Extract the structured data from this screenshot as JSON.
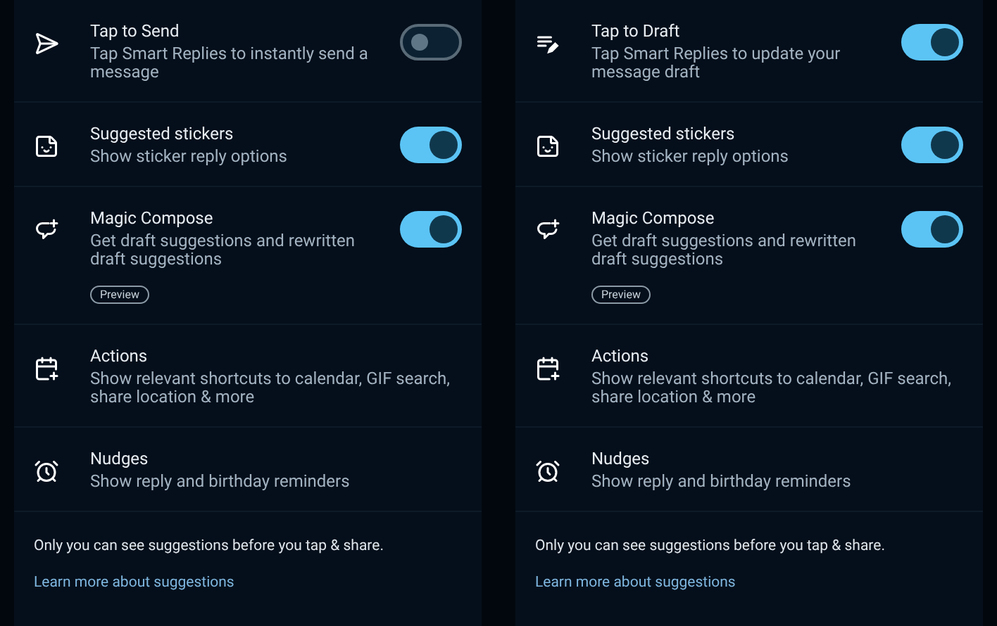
{
  "panels": [
    {
      "settings": [
        {
          "kind": "send",
          "title": "Tap to Send",
          "description": "Tap Smart Replies to instantly send a message",
          "toggle": {
            "on": false
          }
        },
        {
          "kind": "sticker",
          "title": "Suggested stickers",
          "description": "Show sticker reply options",
          "toggle": {
            "on": true
          }
        },
        {
          "kind": "compose",
          "title": "Magic Compose",
          "description": "Get draft suggestions and rewritten draft suggestions",
          "toggle": {
            "on": true
          },
          "badge": "Preview"
        },
        {
          "kind": "calendar",
          "title": "Actions",
          "description": "Show relevant shortcuts to calendar, GIF search, share location & more"
        },
        {
          "kind": "alarm",
          "title": "Nudges",
          "description": "Show reply and birthday reminders"
        }
      ],
      "footer_text": "Only you can see suggestions before you tap & share.",
      "link": "Learn more about suggestions"
    },
    {
      "settings": [
        {
          "kind": "draft",
          "title": "Tap to Draft",
          "description": "Tap Smart Replies to update your message draft",
          "toggle": {
            "on": true
          }
        },
        {
          "kind": "sticker",
          "title": "Suggested stickers",
          "description": "Show sticker reply options",
          "toggle": {
            "on": true
          }
        },
        {
          "kind": "compose",
          "title": "Magic Compose",
          "description": "Get draft suggestions and rewritten draft suggestions",
          "toggle": {
            "on": true
          },
          "badge": "Preview"
        },
        {
          "kind": "calendar",
          "title": "Actions",
          "description": "Show relevant shortcuts to calendar, GIF search, share location & more"
        },
        {
          "kind": "alarm",
          "title": "Nudges",
          "description": "Show reply and birthday reminders"
        }
      ],
      "footer_text": "Only you can see suggestions before you tap & share.",
      "link": "Learn more about suggestions"
    }
  ]
}
